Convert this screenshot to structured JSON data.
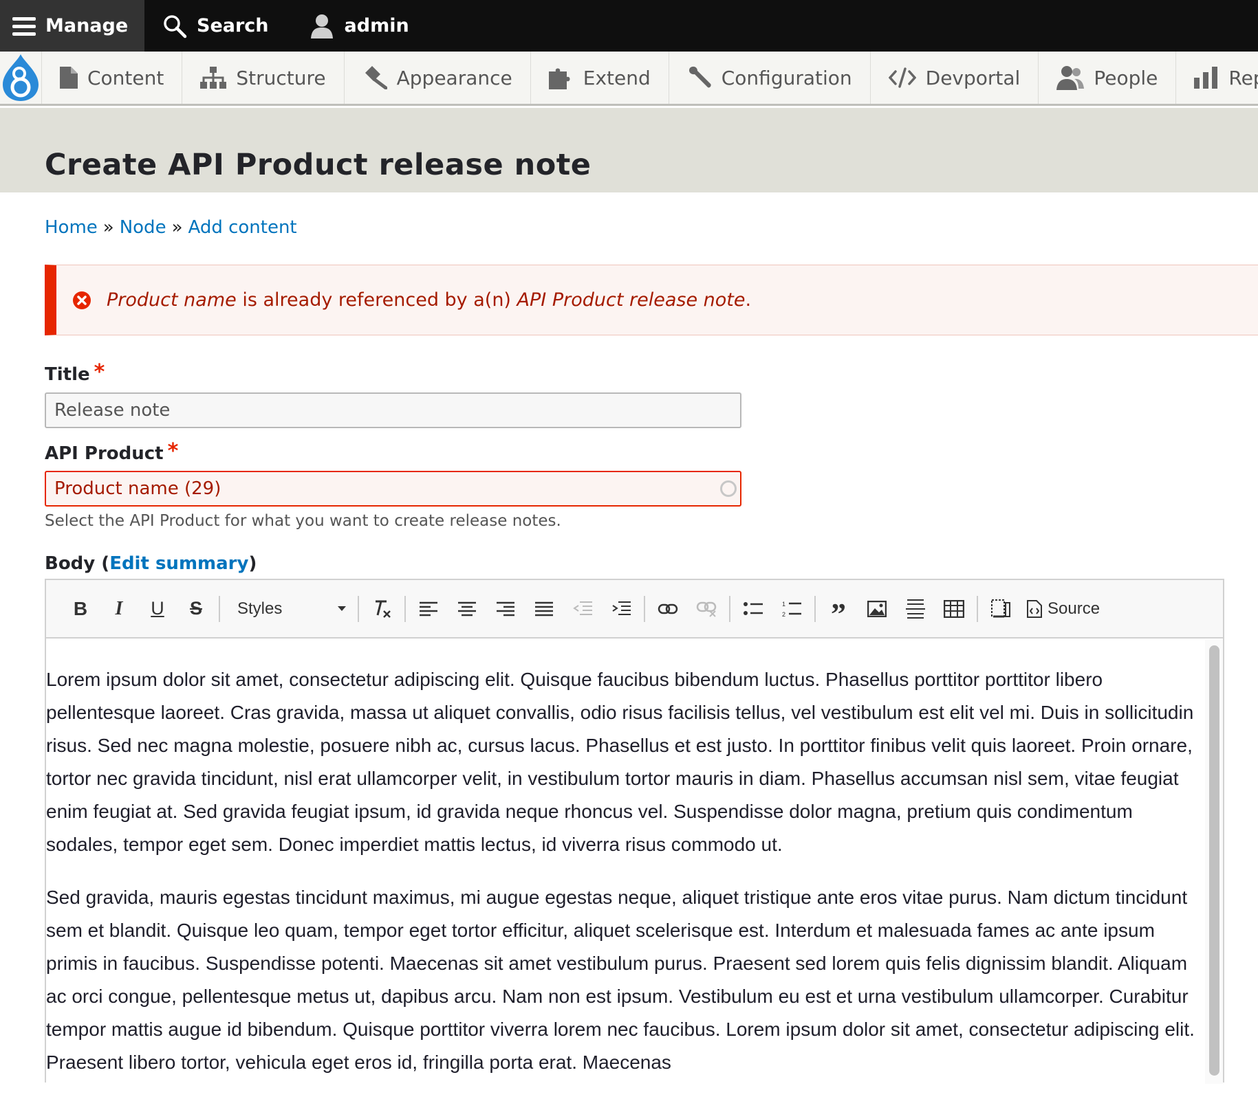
{
  "toolbar": {
    "manage_label": "Manage",
    "search_label": "Search",
    "user_label": "admin"
  },
  "tray": {
    "items": [
      {
        "label": "Content",
        "icon": "file-icon"
      },
      {
        "label": "Structure",
        "icon": "sitemap-icon"
      },
      {
        "label": "Appearance",
        "icon": "brush-icon"
      },
      {
        "label": "Extend",
        "icon": "puzzle-icon"
      },
      {
        "label": "Configuration",
        "icon": "wrench-icon"
      },
      {
        "label": "Devportal",
        "icon": "code-icon"
      },
      {
        "label": "People",
        "icon": "people-icon"
      },
      {
        "label": "Repo",
        "icon": "bar-chart-icon"
      }
    ]
  },
  "page": {
    "title": "Create API Product release note"
  },
  "breadcrumb": {
    "items": [
      "Home",
      "Node",
      "Add content"
    ],
    "separator": "»"
  },
  "error": {
    "field": "Product name",
    "text_mid": " is already referenced by a(n) ",
    "entity": "API Product release note",
    "text_end": "."
  },
  "form": {
    "title_label": "Title",
    "title_value": "Release note",
    "required_mark": "*",
    "product_label": "API Product",
    "product_value": "Product name (29)",
    "product_description": "Select the API Product for what you want to create release notes.",
    "body_label": "Body",
    "body_open": " (",
    "body_close": ")",
    "edit_summary": "Edit summary"
  },
  "editor": {
    "styles_label": "Styles",
    "source_label": "Source",
    "paragraphs": [
      "Lorem ipsum dolor sit amet, consectetur adipiscing elit. Quisque faucibus bibendum luctus. Phasellus porttitor porttitor libero pellentesque laoreet. Cras gravida, massa ut aliquet convallis, odio risus facilisis tellus, vel vestibulum est elit vel mi. Duis in sollicitudin risus. Sed nec magna molestie, posuere nibh ac, cursus lacus. Phasellus et est justo. In porttitor finibus velit quis laoreet. Proin ornare, tortor nec gravida tincidunt, nisl erat ullamcorper velit, in vestibulum tortor mauris in diam. Phasellus accumsan nisl sem, vitae feugiat enim feugiat at. Sed gravida feugiat ipsum, id gravida neque rhoncus vel. Suspendisse dolor magna, pretium quis condimentum sodales, tempor eget sem. Donec imperdiet mattis lectus, id viverra risus commodo ut.",
      "Sed gravida, mauris egestas tincidunt maximus, mi augue egestas neque, aliquet tristique ante eros vitae purus. Nam dictum tincidunt sem et blandit. Quisque leo quam, tempor eget tortor efficitur, aliquet scelerisque est. Interdum et malesuada fames ac ante ipsum primis in faucibus. Suspendisse potenti. Maecenas sit amet vestibulum purus. Praesent sed lorem quis felis dignissim blandit. Aliquam ac orci congue, pellentesque metus ut, dapibus arcu. Nam non est ipsum. Vestibulum eu est et urna vestibulum ullamcorper. Curabitur tempor mattis augue id bibendum. Quisque porttitor viverra lorem nec faucibus. Lorem ipsum dolor sit amet, consectetur adipiscing elit. Praesent libero tortor, vehicula eget eros id, fringilla porta erat. Maecenas"
    ]
  },
  "colors": {
    "link": "#0074bd",
    "error": "#e62600",
    "error_text": "#a51b00",
    "toolbar_bg": "#0f0f0f"
  }
}
